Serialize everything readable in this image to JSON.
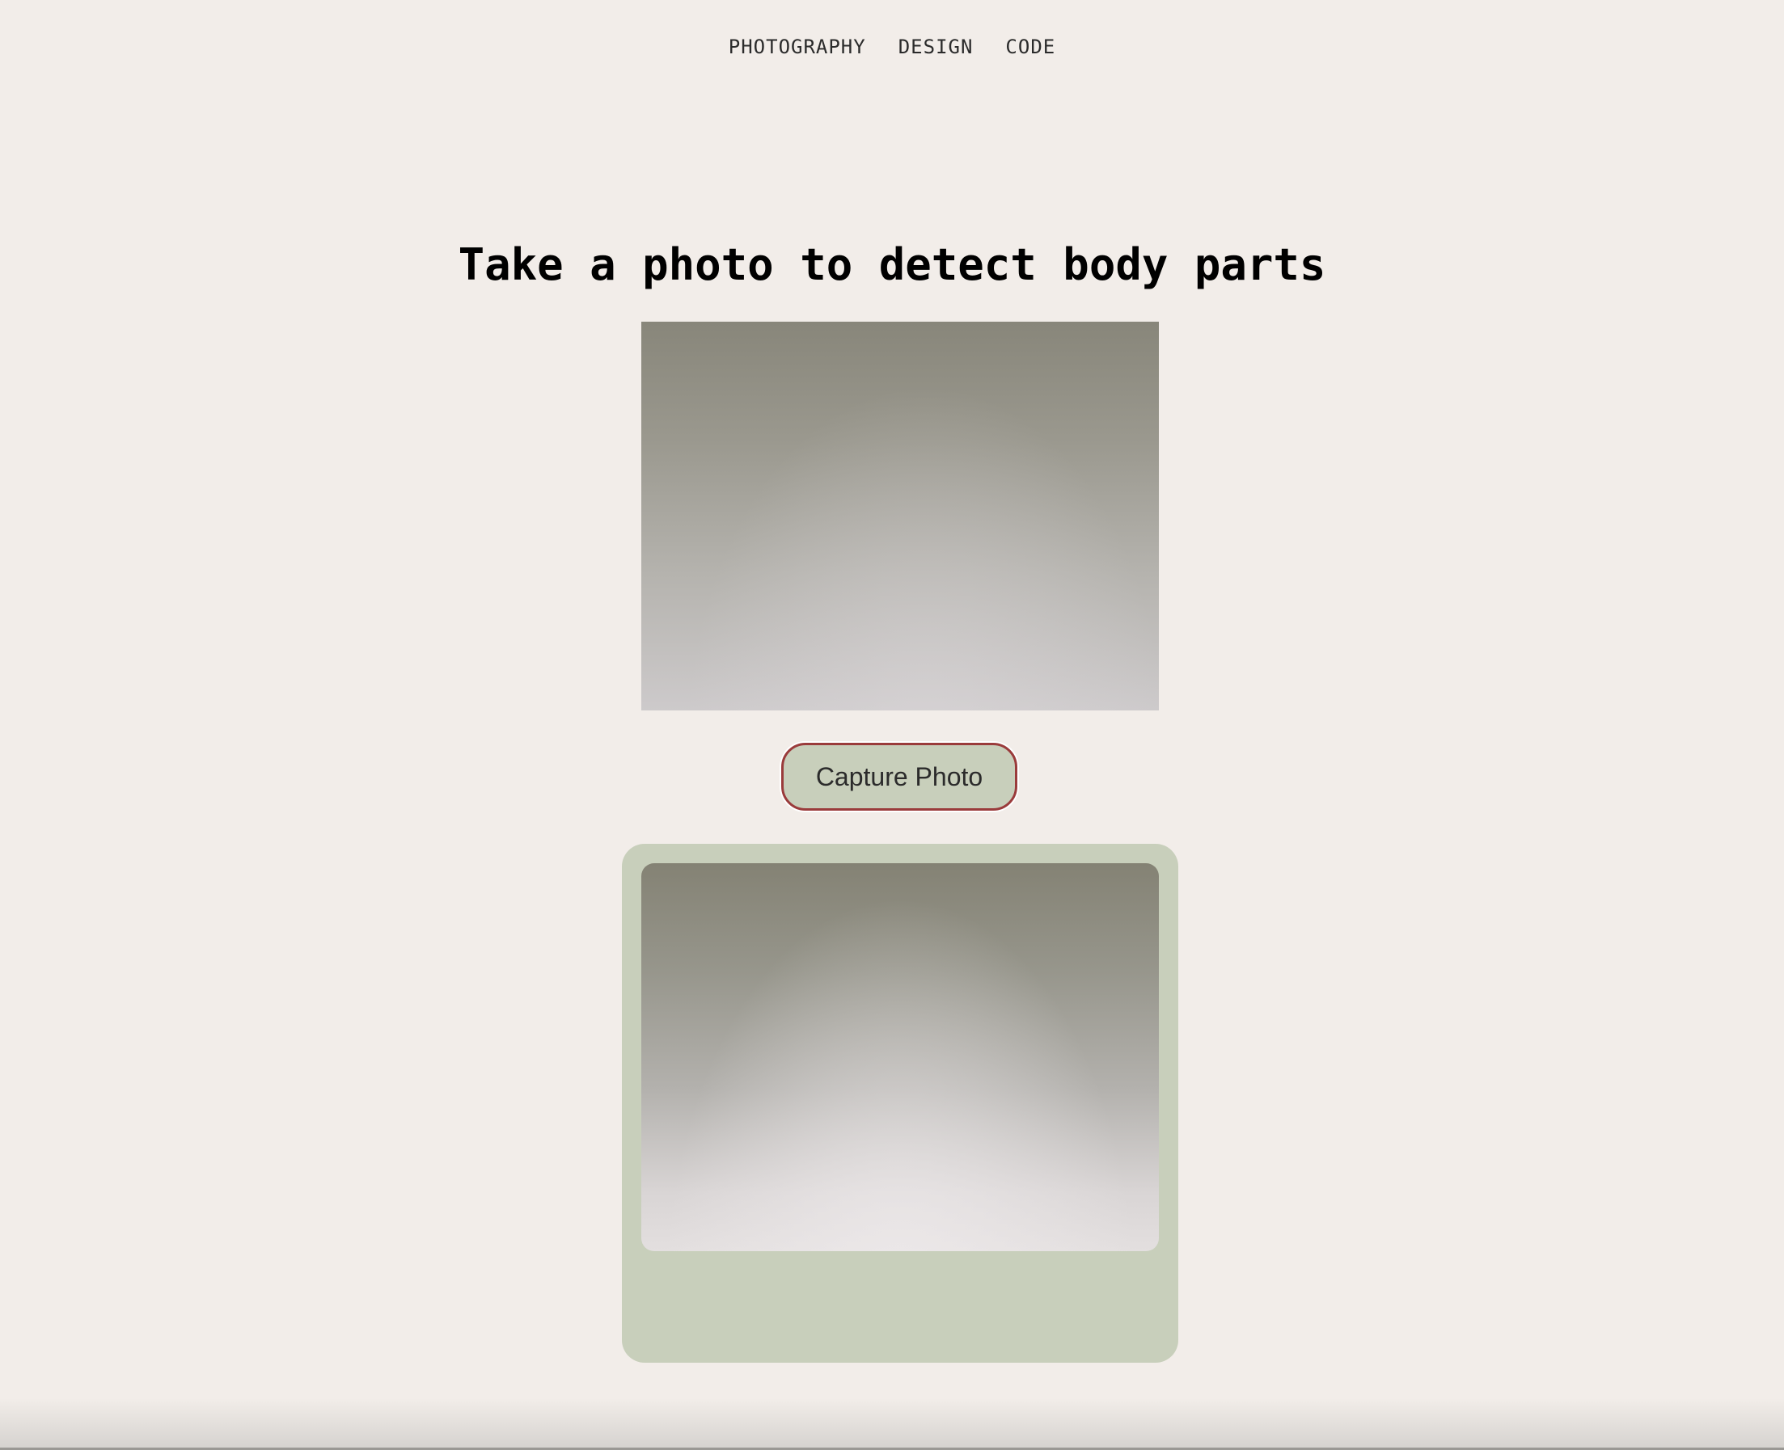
{
  "nav": {
    "items": [
      {
        "label": "PHOTOGRAPHY"
      },
      {
        "label": "DESIGN"
      },
      {
        "label": "CODE"
      }
    ]
  },
  "main": {
    "title": "Take a photo to detect body parts",
    "capture_label": "Capture Photo"
  },
  "colors": {
    "background": "#f2ede9",
    "card": "#c8cfbb",
    "button_border": "#9a3b3b"
  }
}
